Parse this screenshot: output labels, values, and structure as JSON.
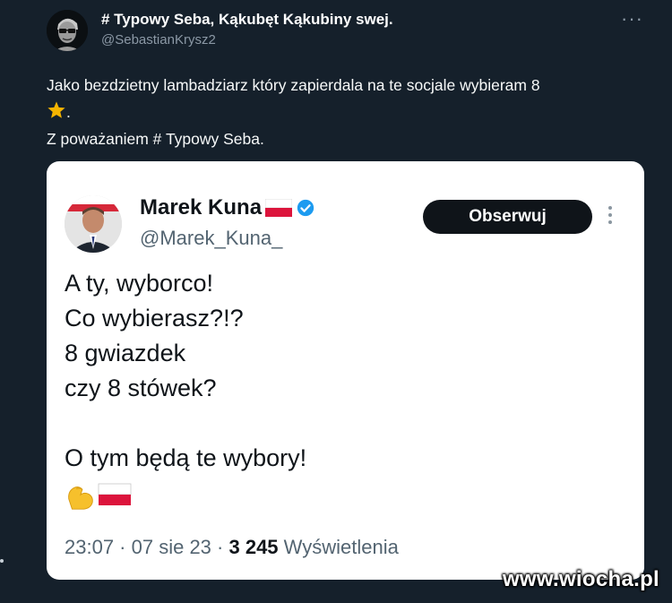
{
  "tweet": {
    "author_name": "# Typowy Seba, Kąkubęt Kąkubiny swej.",
    "author_handle": "@SebastianKrysz2",
    "more_label": "···",
    "text_line1": "Jako bezdzietny lambadziarz który zapierdala na te socjale wybieram 8",
    "text_line2_suffix": ".",
    "text_line3": "Z poważaniem # Typowy Seba."
  },
  "quoted": {
    "author_name": "Marek Kuna",
    "author_handle": "@Marek_Kuna_",
    "follow_label": "Obserwuj",
    "lines": [
      "A ty, wyborco!",
      "Co wybierasz?!?",
      "8 gwiazdek",
      "czy 8 stówek?",
      "",
      "O tym będą te wybory!"
    ],
    "time": "23:07",
    "date": "07 sie 23",
    "views_count": "3 245",
    "views_label": "Wyświetlenia"
  },
  "watermark": "www.wiocha.pl",
  "icons": {
    "star": "star-emoji-icon",
    "flag": "poland-flag-icon",
    "biceps": "flexed-biceps-icon",
    "verified": "verified-badge-icon"
  },
  "colors": {
    "background": "#15202b",
    "card": "#ffffff",
    "follow_button": "#0f1419",
    "verified": "#1d9bf0",
    "star": "#f5b400"
  }
}
